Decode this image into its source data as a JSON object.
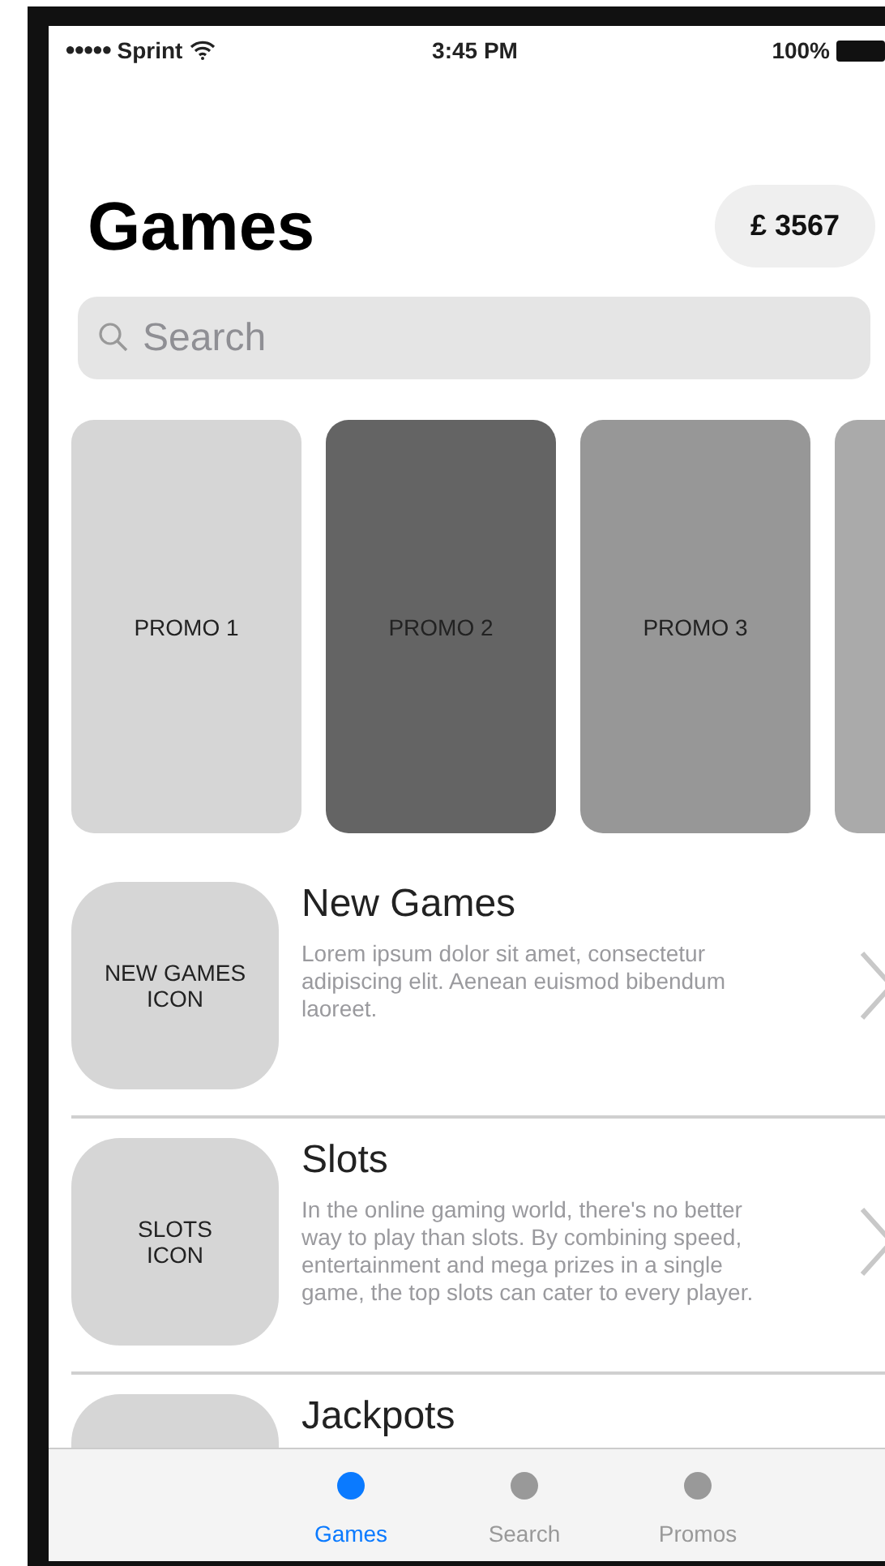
{
  "status_bar": {
    "signal_dots": "●●●●●",
    "carrier": "Sprint",
    "time": "3:45 PM",
    "battery": "100%"
  },
  "header": {
    "title": "Games",
    "balance": "£ 3567"
  },
  "search": {
    "placeholder": "Search"
  },
  "promos": [
    {
      "label": "PROMO 1",
      "color": "#d6d6d6"
    },
    {
      "label": "PROMO 2",
      "color": "#646464"
    },
    {
      "label": "PROMO 3",
      "color": "#979797"
    },
    {
      "color": "#aaaaaa"
    }
  ],
  "categories": [
    {
      "icon_label": [
        "NEW GAMES",
        "ICON"
      ],
      "title": "New Games",
      "description": "Lorem ipsum dolor sit amet, consectetur adipiscing elit. Aenean euismod bibendum laoreet."
    },
    {
      "icon_label": [
        "SLOTS",
        "ICON"
      ],
      "title": "Slots",
      "description": "In the online gaming world, there's no better way to play than slots. By combining speed, entertainment and mega prizes in a single game, the top slots can cater to every player."
    },
    {
      "title": "Jackpots"
    }
  ],
  "tab_bar": [
    {
      "label": "Games",
      "selected": true
    },
    {
      "label": "Search",
      "selected": false
    },
    {
      "label": "Promos",
      "selected": false
    }
  ]
}
